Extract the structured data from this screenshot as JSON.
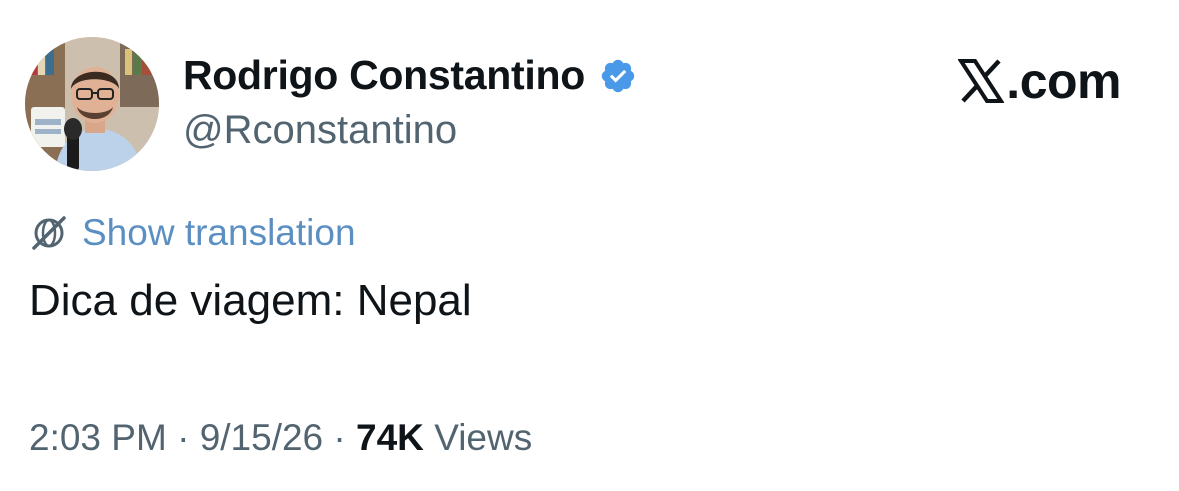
{
  "author": {
    "display_name": "Rodrigo Constantino",
    "handle": "@Rconstantino",
    "verified": true
  },
  "site": {
    "logo_text": ".com",
    "logo_icon": "x-logo-icon"
  },
  "translation": {
    "icon": "globe-slash-icon",
    "label": "Show translation"
  },
  "tweet": {
    "text": "Dica de viagem: Nepal"
  },
  "meta": {
    "time": "2:03 PM",
    "separator": "·",
    "date": "9/15/26",
    "views_count": "74K",
    "views_label": "Views"
  },
  "colors": {
    "verified_badge": "#4a99e9",
    "link": "#5b8fc2",
    "secondary_text": "#536471",
    "primary_text": "#0f1419"
  }
}
